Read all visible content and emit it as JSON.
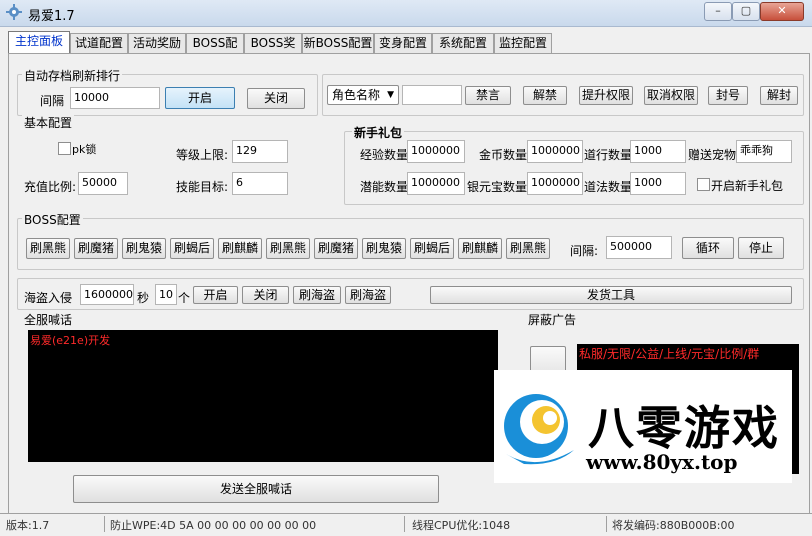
{
  "window": {
    "title": "易爱1.7",
    "min": "–",
    "max": "▢",
    "close": "✕"
  },
  "tabs": [
    "主控面板",
    "试道配置",
    "活动奖励",
    "BOSS配置",
    "BOSS奖励",
    "新BOSS配置",
    "变身配置",
    "系统配置",
    "监控配置"
  ],
  "autosave": {
    "label": "自动存档刷新排行",
    "interval_label": "间隔",
    "interval_value": "10000",
    "open": "开启",
    "close": "关闭"
  },
  "player": {
    "select_value": "角色名称",
    "input_value": "",
    "buttons": [
      "禁言",
      "解禁",
      "提升权限",
      "取消权限",
      "封号",
      "解封"
    ]
  },
  "basic": {
    "label": "基本配置",
    "pk_lock": "pk锁",
    "level_cap_label": "等级上限:",
    "level_cap": "129",
    "recharge_label": "充值比例:",
    "recharge": "50000",
    "skill_label": "技能目标:",
    "skill": "6"
  },
  "newbie": {
    "label": "新手礼包",
    "exp_label": "经验数量",
    "exp": "1000000",
    "gold_label": "金币数量",
    "gold": "1000000",
    "dao_label": "道行数量",
    "dao": "1000",
    "pet_label": "赠送宠物",
    "pet": "乖乖狗",
    "pot_label": "潜能数量",
    "pot": "1000000",
    "silver_label": "银元宝数量",
    "silver": "1000000",
    "fa_label": "道法数量",
    "fa": "1000",
    "enable_label": "开启新手礼包"
  },
  "boss": {
    "label": "BOSS配置",
    "buttons": [
      "刷黑熊",
      "刷魔猪",
      "刷鬼猿",
      "刷蝎后",
      "刷麒麟",
      "刷黑熊",
      "刷魔猪",
      "刷鬼猿",
      "刷蝎后",
      "刷麒麟",
      "刷黑熊"
    ],
    "interval_label": "间隔:",
    "interval": "500000",
    "loop": "循环",
    "stop": "停止"
  },
  "pirate": {
    "label": "海盗入侵",
    "value": "1600000",
    "sec": "秒",
    "count": "10",
    "unit": "个",
    "open": "开启",
    "close": "关闭",
    "btn1": "刷海盗",
    "btn2": "刷海盗",
    "tool": "发货工具"
  },
  "shout": {
    "label": "全服喊话",
    "line": "易爱(e21e)开发",
    "send": "发送全服喊话"
  },
  "ads": {
    "label": "屏蔽广告",
    "line": "私服/无限/公益/上线/元宝/比例/群"
  },
  "status": {
    "s1": "版本:1.7",
    "s2": "防止WPE:4D 5A 00 00 00 00 00 00 00",
    "s3": "线程CPU优化:1048",
    "s4": "将发编码:880B000B:00"
  },
  "watermark": {
    "name": "八零游戏",
    "url": "www.80yx.top"
  },
  "colors": {
    "accent_tab": "#0033cc",
    "log_red": "#ff2a2a",
    "brand_blue": "#1a8fd8",
    "brand_yellow": "#f4c430"
  }
}
